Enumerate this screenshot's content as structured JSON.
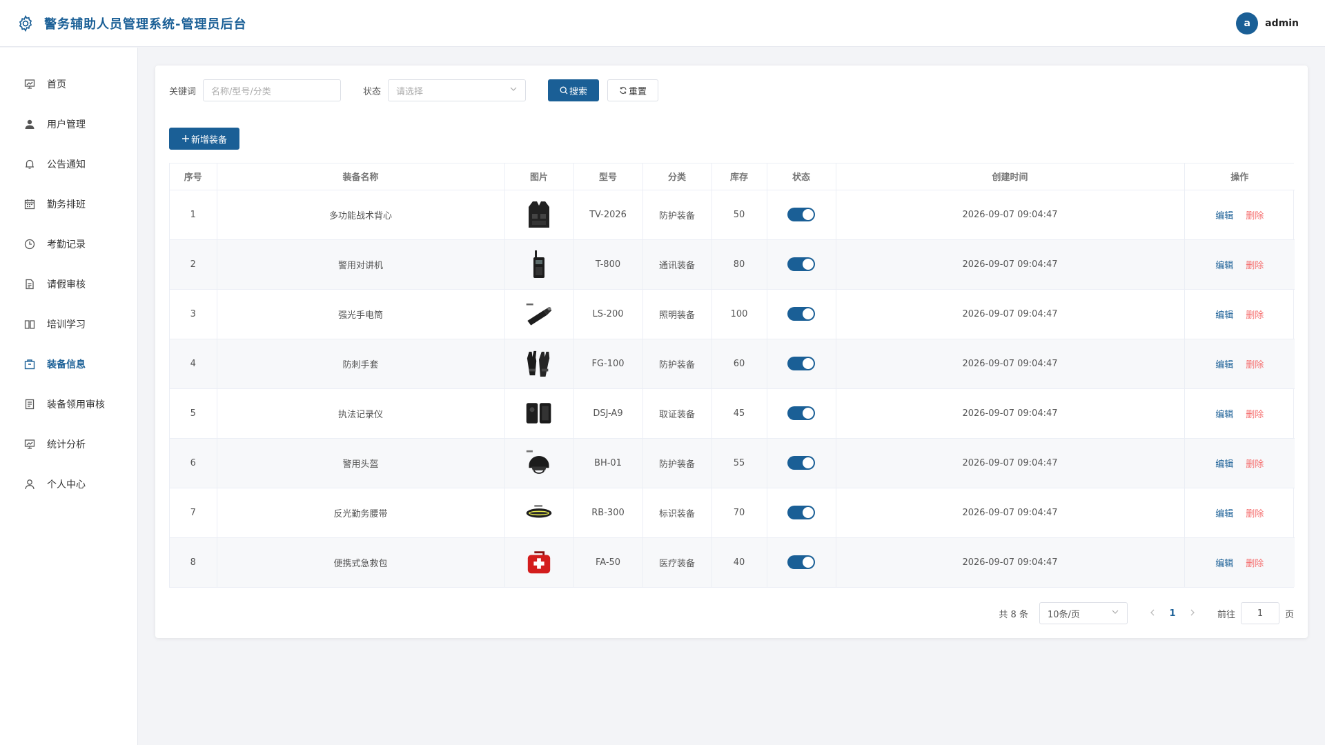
{
  "header": {
    "title": "警务辅助人员管理系统-管理员后台",
    "logo_icon": "gear-icon",
    "avatar_letter": "a",
    "username": "admin",
    "accent_color": "#1a5f96"
  },
  "sidebar": {
    "items": [
      {
        "label": "首页",
        "icon": "dashboard-icon"
      },
      {
        "label": "用户管理",
        "icon": "user-icon"
      },
      {
        "label": "公告通知",
        "icon": "bell-icon"
      },
      {
        "label": "勤务排班",
        "icon": "calendar-icon"
      },
      {
        "label": "考勤记录",
        "icon": "clock-icon"
      },
      {
        "label": "请假审核",
        "icon": "document-icon"
      },
      {
        "label": "培训学习",
        "icon": "book-icon"
      },
      {
        "label": "装备信息",
        "icon": "package-icon",
        "active": true
      },
      {
        "label": "装备领用审核",
        "icon": "checklist-icon"
      },
      {
        "label": "统计分析",
        "icon": "chart-icon"
      },
      {
        "label": "个人中心",
        "icon": "person-icon"
      }
    ]
  },
  "search": {
    "keyword_label": "关键词",
    "keyword_placeholder": "名称/型号/分类",
    "status_label": "状态",
    "status_placeholder": "请选择",
    "search_button": "搜索",
    "reset_button": "重置",
    "add_button": "新增装备"
  },
  "table": {
    "columns": [
      "序号",
      "装备名称",
      "图片",
      "型号",
      "分类",
      "库存",
      "状态",
      "创建时间",
      "操作"
    ],
    "edit_label": "编辑",
    "delete_label": "删除",
    "rows": [
      {
        "no": "1",
        "name": "多功能战术背心",
        "image": "vest",
        "model": "TV-2026",
        "category": "防护装备",
        "stock": "50",
        "status_on": true,
        "created": "2026-09-07 09:04:47"
      },
      {
        "no": "2",
        "name": "警用对讲机",
        "image": "radio",
        "model": "T-800",
        "category": "通讯装备",
        "stock": "80",
        "status_on": true,
        "created": "2026-09-07 09:04:47"
      },
      {
        "no": "3",
        "name": "强光手电筒",
        "image": "flashlight",
        "model": "LS-200",
        "category": "照明装备",
        "stock": "100",
        "status_on": true,
        "created": "2026-09-07 09:04:47"
      },
      {
        "no": "4",
        "name": "防刺手套",
        "image": "gloves",
        "model": "FG-100",
        "category": "防护装备",
        "stock": "60",
        "status_on": true,
        "created": "2026-09-07 09:04:47"
      },
      {
        "no": "5",
        "name": "执法记录仪",
        "image": "camera",
        "model": "DSJ-A9",
        "category": "取证装备",
        "stock": "45",
        "status_on": true,
        "created": "2026-09-07 09:04:47"
      },
      {
        "no": "6",
        "name": "警用头盔",
        "image": "helmet",
        "model": "BH-01",
        "category": "防护装备",
        "stock": "55",
        "status_on": true,
        "created": "2026-09-07 09:04:47"
      },
      {
        "no": "7",
        "name": "反光勤务腰带",
        "image": "belt",
        "model": "RB-300",
        "category": "标识装备",
        "stock": "70",
        "status_on": true,
        "created": "2026-09-07 09:04:47"
      },
      {
        "no": "8",
        "name": "便携式急救包",
        "image": "firstaid",
        "model": "FA-50",
        "category": "医疗装备",
        "stock": "40",
        "status_on": true,
        "created": "2026-09-07 09:04:47"
      }
    ]
  },
  "pagination": {
    "total": "共 8 条",
    "page_size": "10条/页",
    "current_page": "1",
    "goto_label": "前往",
    "goto_value": "1",
    "page_suffix": "页"
  }
}
